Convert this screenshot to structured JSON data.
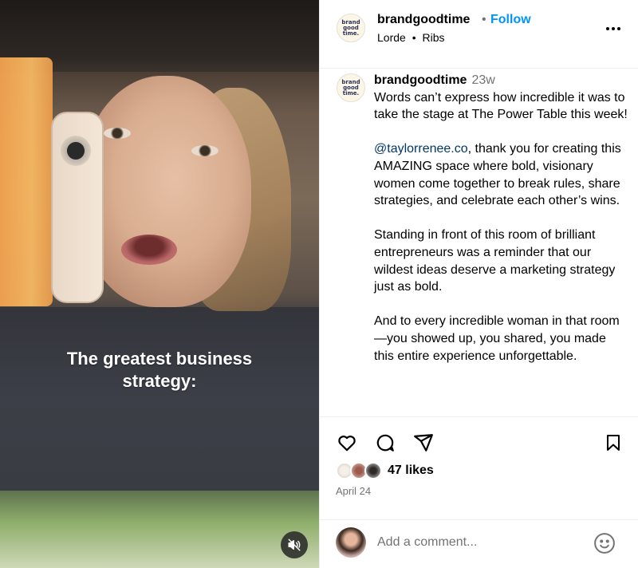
{
  "video": {
    "overlay_caption_line1": "The greatest business",
    "overlay_caption_line2": "strategy:",
    "muted": true
  },
  "header": {
    "logo_text": [
      "brand",
      "good",
      "time."
    ],
    "username": "brandgoodtime",
    "separator": "•",
    "follow_label": "Follow",
    "audio_artist": "Lorde",
    "audio_separator": "•",
    "audio_track": "Ribs",
    "more_icon": "more-horizontal-icon"
  },
  "caption": {
    "username": "brandgoodtime",
    "time_ago": "23w",
    "p1": "Words can’t express how incredible it was to take the stage at The Power Table this week!",
    "p2_mention": "@taylorrenee.co",
    "p2_rest": ", thank you for creating this AMAZING space where bold, visionary women come together to break rules, share strategies, and celebrate each other’s wins.",
    "p3": "Standing in front of this room of brilliant entrepreneurs was a reminder that our wildest ideas deserve a marketing strategy just as bold.",
    "p4": "And to every incredible woman in that room—you showed up, you shared, you made this entire experience unforgettable."
  },
  "actions": {
    "icons": [
      "heart-icon",
      "comment-icon",
      "share-icon",
      "bookmark-icon"
    ],
    "likes": "47 likes",
    "date": "April 24"
  },
  "comment_box": {
    "placeholder": "Add a comment...",
    "emoji_icon": "emoji-icon"
  },
  "colors": {
    "follow_blue": "#0095f6",
    "mention": "#00376b",
    "secondary_text": "#737373",
    "divider": "#efefef"
  }
}
